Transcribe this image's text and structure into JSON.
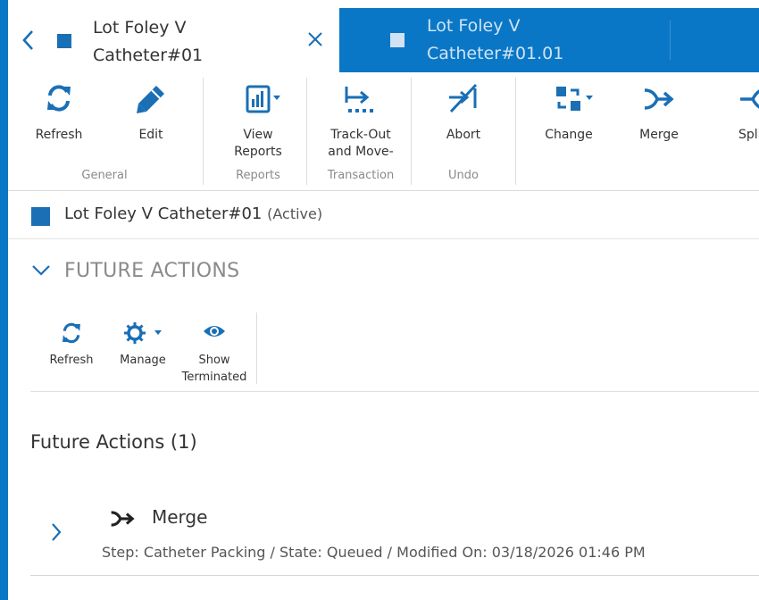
{
  "tabs": [
    {
      "line1": "Lot Foley V",
      "line2": "Catheter#01",
      "active": true
    },
    {
      "line1": "Lot Foley V",
      "line2": "Catheter#01.01",
      "active": false
    }
  ],
  "ribbon": {
    "general": {
      "label": "General",
      "refresh": "Refresh",
      "edit": "Edit"
    },
    "reports": {
      "label": "Reports",
      "view_reports_1": "View",
      "view_reports_2": "Reports"
    },
    "transaction": {
      "label": "Transaction",
      "trackout_1": "Track-Out",
      "trackout_2": "and Move-"
    },
    "undo": {
      "label": "Undo",
      "abort": "Abort"
    },
    "change": "Change",
    "merge": "Merge",
    "split": "Split"
  },
  "lot": {
    "name": "Lot Foley V Catheter#01",
    "state": "(Active)"
  },
  "future_actions": {
    "section_title": "FUTURE ACTIONS",
    "toolbar": {
      "refresh": "Refresh",
      "manage": "Manage",
      "show_1": "Show",
      "show_2": "Terminated"
    },
    "count_title": "Future Actions (1)",
    "items": [
      {
        "name": "Merge",
        "detail": "Step: Catheter Packing / State: Queued / Modified On: 03/18/2026 01:46 PM"
      }
    ]
  },
  "colors": {
    "accent": "#0a77c6",
    "icon": "#1a6fb5",
    "header_text": "#ffffff"
  }
}
